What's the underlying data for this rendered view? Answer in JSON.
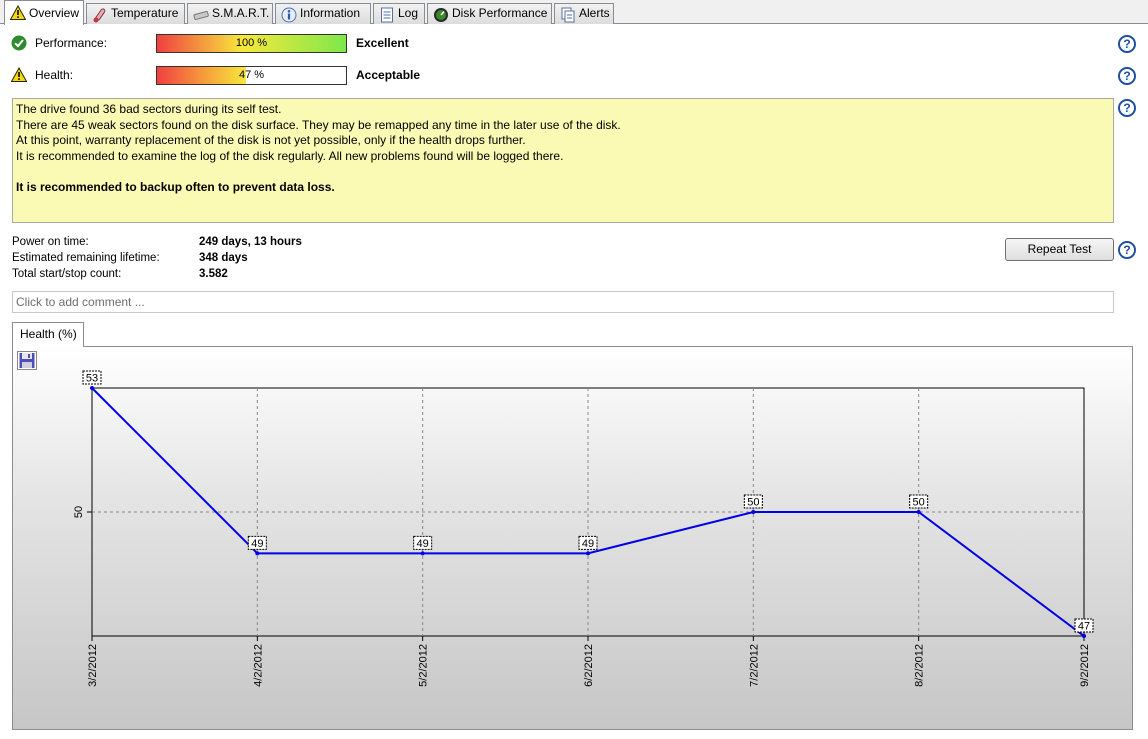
{
  "tabs": [
    {
      "label": "Overview",
      "icon": "warning-icon",
      "active": true
    },
    {
      "label": "Temperature",
      "icon": "thermometer-icon",
      "active": false
    },
    {
      "label": "S.M.A.R.T.",
      "icon": "smart-icon",
      "active": false
    },
    {
      "label": "Information",
      "icon": "info-icon",
      "active": false
    },
    {
      "label": "Log",
      "icon": "log-icon",
      "active": false
    },
    {
      "label": "Disk Performance",
      "icon": "gauge-icon",
      "active": false
    },
    {
      "label": "Alerts",
      "icon": "alerts-icon",
      "active": false
    }
  ],
  "performance": {
    "label": "Performance:",
    "percent": 100,
    "percent_text": "100 %",
    "status": "Excellent"
  },
  "health": {
    "label": "Health:",
    "percent": 47,
    "percent_text": "47 %",
    "status": "Acceptable"
  },
  "message": {
    "lines": [
      "The drive found 36 bad sectors during its self test.",
      "There are 45 weak sectors found on the disk surface. They may be remapped any time in the later use of the disk.",
      "At this point, warranty replacement of the disk is not yet possible, only if the health drops further.",
      "It is recommended to examine the log of the disk regularly. All new problems found will be logged there."
    ],
    "bold": "It is recommended to backup often to prevent data loss."
  },
  "info": {
    "power_on_label": "Power on time:",
    "power_on_value": "249 days, 13 hours",
    "lifetime_label": "Estimated remaining lifetime:",
    "lifetime_value": "348 days",
    "startstop_label": "Total start/stop count:",
    "startstop_value": "3.582"
  },
  "repeat_test_label": "Repeat Test",
  "comment_placeholder": "Click to add comment ...",
  "chart_tab_label": "Health (%)",
  "colors": {
    "line": "#0000e6",
    "message_bg": "#fafab4",
    "help": "#1f4f9e"
  },
  "chart_data": {
    "type": "line",
    "title": "",
    "xlabel": "",
    "ylabel": "",
    "x": [
      "3/2/2012",
      "4/2/2012",
      "5/2/2012",
      "6/2/2012",
      "7/2/2012",
      "8/2/2012",
      "9/2/2012"
    ],
    "series": [
      {
        "values": [
          53,
          49,
          49,
          49,
          50,
          50,
          47
        ]
      }
    ],
    "y_ticks": [
      50
    ],
    "ylim": [
      47,
      53
    ],
    "grid": true
  }
}
